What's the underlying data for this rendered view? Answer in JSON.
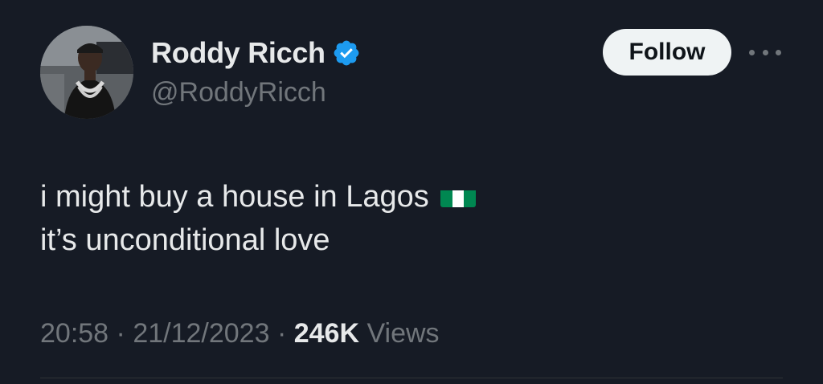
{
  "author": {
    "display_name": "Roddy Ricch",
    "handle": "@RoddyRicch",
    "verified": true,
    "avatar_icon": "profile-photo"
  },
  "actions": {
    "follow_label": "Follow",
    "more_icon": "more-horizontal-icon"
  },
  "tweet": {
    "lines": [
      "i might buy a house in Lagos",
      "it’s unconditional love"
    ],
    "emoji": "nigeria-flag-icon"
  },
  "meta": {
    "time": "20:58",
    "separator": "·",
    "date": "21/12/2023",
    "views_count": "246K",
    "views_label": "Views"
  },
  "colors": {
    "background": "#161b25",
    "text_primary": "#e7e9ea",
    "text_secondary": "#71767b",
    "verified_blue": "#1d9bf0",
    "follow_bg": "#eff3f4",
    "flag_green": "#008751"
  }
}
